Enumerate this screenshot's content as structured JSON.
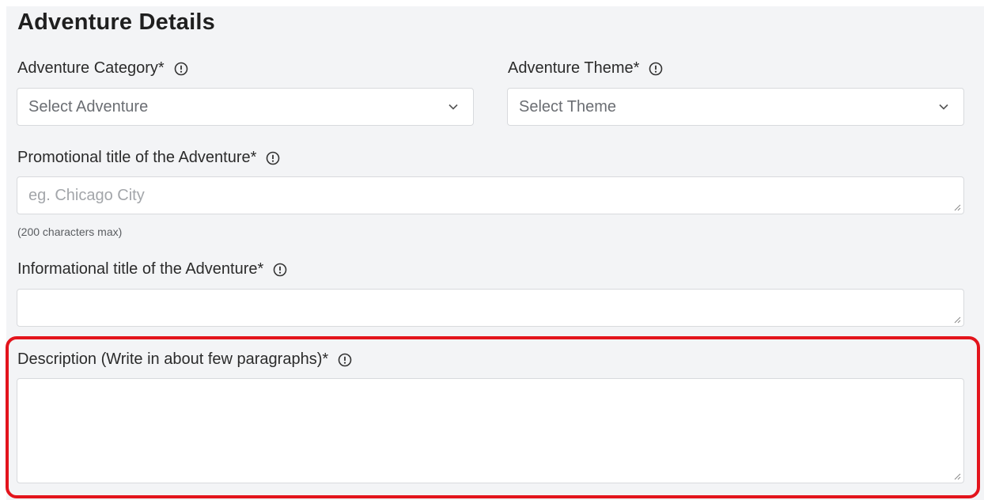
{
  "section": {
    "title": "Adventure Details"
  },
  "category": {
    "label": "Adventure Category*",
    "selected": "Select Adventure"
  },
  "theme": {
    "label": "Adventure Theme*",
    "selected": "Select Theme"
  },
  "promo_title": {
    "label": "Promotional title of the Adventure*",
    "placeholder": "eg. Chicago City",
    "hint": "(200 characters max)"
  },
  "info_title": {
    "label": "Informational title of the Adventure*",
    "value": ""
  },
  "description": {
    "label": "Description (Write in about few paragraphs)*",
    "value": ""
  },
  "colors": {
    "highlight": "#e3141c",
    "panel_bg": "#f3f4f6"
  }
}
